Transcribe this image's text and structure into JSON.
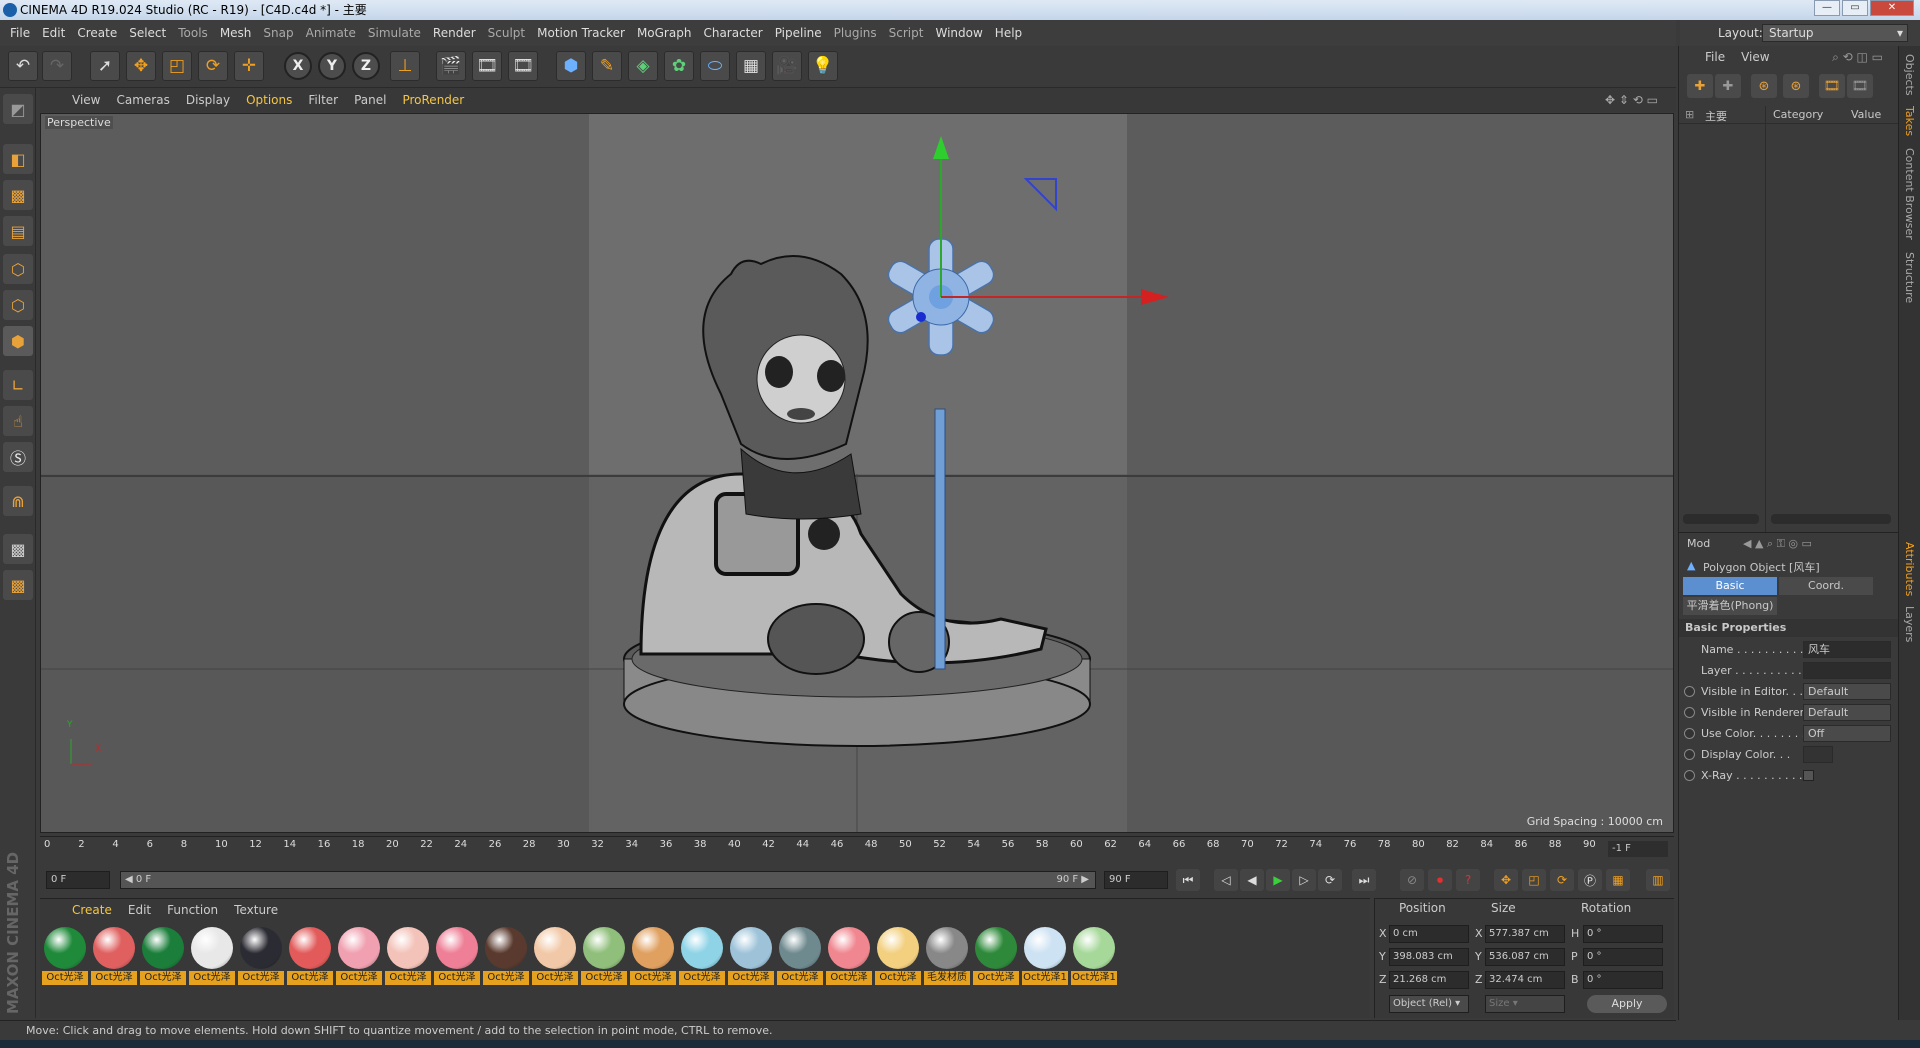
{
  "window": {
    "title": "CINEMA 4D R19.024 Studio (RC - R19) - [C4D.c4d *] - 主要",
    "layout_label": "Layout:",
    "layout_value": "Startup"
  },
  "menu": [
    "File",
    "Edit",
    "Create",
    "Select",
    "Tools",
    "Mesh",
    "Snap",
    "Animate",
    "Simulate",
    "Render",
    "Sculpt",
    "Motion Tracker",
    "MoGraph",
    "Character",
    "Pipeline",
    "Plugins",
    "Script",
    "Window",
    "Help"
  ],
  "toolbar": {
    "x_label": "X",
    "y_label": "Y",
    "z_label": "Z"
  },
  "viewport": {
    "menu": [
      "View",
      "Cameras",
      "Display",
      "Options",
      "Filter",
      "Panel",
      "ProRender"
    ],
    "camera_label": "Perspective",
    "grid_spacing": "Grid Spacing : 10000 cm",
    "axis_y": "Y",
    "axis_x": "X"
  },
  "timeline": {
    "ticks": [
      "0",
      "2",
      "4",
      "6",
      "8",
      "10",
      "12",
      "14",
      "16",
      "18",
      "20",
      "22",
      "24",
      "26",
      "28",
      "30",
      "32",
      "34",
      "36",
      "38",
      "40",
      "42",
      "44",
      "46",
      "48",
      "50",
      "52",
      "54",
      "56",
      "58",
      "60",
      "62",
      "64",
      "66",
      "68",
      "70",
      "72",
      "74",
      "76",
      "78",
      "80",
      "82",
      "84",
      "86",
      "88",
      "90"
    ],
    "end_frame": "-1 F",
    "current_frame": "0 F",
    "range_start": "◀ 0 F",
    "range_end": "90 F ▶",
    "max_frame": "90 F"
  },
  "materials": {
    "menu": [
      "Create",
      "Edit",
      "Function",
      "Texture"
    ],
    "items": [
      {
        "label": "Oct光泽",
        "color": "#1f8a3a"
      },
      {
        "label": "Oct光泽",
        "color": "#e06060"
      },
      {
        "label": "Oct光泽",
        "color": "#1b7f3b"
      },
      {
        "label": "Oct光泽",
        "color": "#e8e8e8"
      },
      {
        "label": "Oct光泽",
        "color": "#2b2b33"
      },
      {
        "label": "Oct光泽",
        "color": "#e25a5a"
      },
      {
        "label": "Oct光泽",
        "color": "#f0a0b0"
      },
      {
        "label": "Oct光泽",
        "color": "#f3c2b8"
      },
      {
        "label": "Oct光泽",
        "color": "#ee7f96"
      },
      {
        "label": "Oct光泽",
        "color": "#5a3a2e"
      },
      {
        "label": "Oct光泽",
        "color": "#f2c9a8"
      },
      {
        "label": "Oct光泽",
        "color": "#8fbf7a"
      },
      {
        "label": "Oct光泽",
        "color": "#e0a060"
      },
      {
        "label": "Oct光泽",
        "color": "#8fd3e6"
      },
      {
        "label": "Oct光泽",
        "color": "#9ec3d9"
      },
      {
        "label": "Oct光泽",
        "color": "#6e8a8f"
      },
      {
        "label": "Oct光泽",
        "color": "#f0868f"
      },
      {
        "label": "Oct光泽",
        "color": "#f2d080"
      },
      {
        "label": "毛发材质",
        "color": "#888888"
      },
      {
        "label": "Oct光泽",
        "color": "#2e8a3a"
      },
      {
        "label": "Oct光泽1",
        "color": "#cde2f2"
      },
      {
        "label": "Oct光泽1",
        "color": "#a6d89a"
      }
    ]
  },
  "coords": {
    "headers": [
      "Position",
      "Size",
      "Rotation"
    ],
    "pos": [
      {
        "axis": "X",
        "value": "0 cm"
      },
      {
        "axis": "Y",
        "value": "398.083 cm"
      },
      {
        "axis": "Z",
        "value": "21.268 cm"
      }
    ],
    "size": [
      {
        "axis": "X",
        "value": "577.387 cm"
      },
      {
        "axis": "Y",
        "value": "536.087 cm"
      },
      {
        "axis": "Z",
        "value": "32.474 cm"
      }
    ],
    "rot": [
      {
        "axis": "H",
        "value": "0 °"
      },
      {
        "axis": "P",
        "value": "0 °"
      },
      {
        "axis": "B",
        "value": "0 °"
      }
    ],
    "mode": "Object (Rel)",
    "size_mode": "Size",
    "apply": "Apply"
  },
  "status": "Move: Click and drag to move elements. Hold down SHIFT to quantize movement / add to the selection in point mode, CTRL to remove.",
  "brand": "MAXON CINEMA 4D",
  "objects_panel": {
    "menu": [
      "File",
      "View"
    ],
    "tree_item": "主要",
    "col_category": "Category",
    "col_value": "Value"
  },
  "attributes": {
    "mode": "Mod",
    "object_title": "Polygon Object [风车]",
    "tabs": [
      "Basic",
      "Coord."
    ],
    "phong_tab": "平滑着色(Phong)",
    "section": "Basic Properties",
    "rows": [
      {
        "label": "Name . . . . . . . . . . .",
        "value": "风车"
      },
      {
        "label": "Layer . . . . . . . . . . .",
        "value": ""
      },
      {
        "label": "Visible in Editor. . .",
        "value": "Default"
      },
      {
        "label": "Visible in Renderer",
        "value": "Default"
      },
      {
        "label": "Use Color. . . . . . . .",
        "value": "Off"
      },
      {
        "label": "Display Color. . .",
        "value": ""
      },
      {
        "label": "X-Ray . . . . . . . . . . .",
        "value": ""
      }
    ]
  },
  "side_tabs": [
    "Objects",
    "Takes",
    "Content Browser",
    "Structure",
    "Attributes",
    "Layers"
  ]
}
